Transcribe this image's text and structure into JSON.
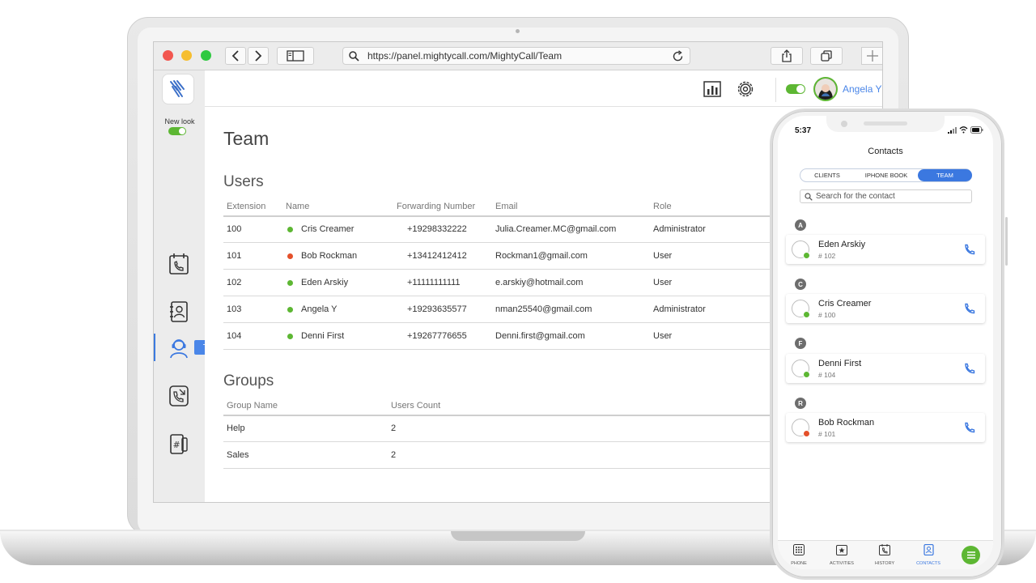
{
  "browser": {
    "url": "https://panel.mightycall.com/MightyCall/Team"
  },
  "sidebar": {
    "new_look_label": "New look",
    "tooltip": "Team",
    "items": [
      {
        "icon": "calendar-phone-icon"
      },
      {
        "icon": "contacts-book-icon"
      },
      {
        "icon": "team-headset-icon"
      },
      {
        "icon": "call-forward-icon"
      },
      {
        "icon": "phone-numbers-icon"
      }
    ]
  },
  "header": {
    "user_name": "Angela Y"
  },
  "page": {
    "title": "Team",
    "users_title": "Users",
    "users_columns": [
      "Extension",
      "Name",
      "Forwarding Number",
      "Email",
      "Role"
    ],
    "users": [
      {
        "extension": "100",
        "name": "Cris Creamer",
        "forwarding": "+19298332222",
        "email": "Julia.Creamer.MC@gmail.com",
        "role": "Administrator",
        "status_color": "#5db733"
      },
      {
        "extension": "101",
        "name": "Bob Rockman",
        "forwarding": "+13412412412",
        "email": "Rockman1@gmail.com",
        "role": "User",
        "status_color": "#e4502a"
      },
      {
        "extension": "102",
        "name": "Eden Arskiy",
        "forwarding": "+11111111111",
        "email": "e.arskiy@hotmail.com",
        "role": "User",
        "status_color": "#5db733"
      },
      {
        "extension": "103",
        "name": "Angela Y",
        "forwarding": "+19293635577",
        "email": "nman25540@gmail.com",
        "role": "Administrator",
        "status_color": "#5db733"
      },
      {
        "extension": "104",
        "name": "Denni First",
        "forwarding": "+19267776655",
        "email": "Denni.first@gmail.com",
        "role": "User",
        "status_color": "#5db733"
      }
    ],
    "groups_title": "Groups",
    "groups_columns": [
      "Group Name",
      "Users Count"
    ],
    "groups": [
      {
        "name": "Help",
        "count": "2"
      },
      {
        "name": "Sales",
        "count": "2"
      }
    ]
  },
  "phone": {
    "time": "5:37",
    "title": "Contacts",
    "segments": [
      "CLIENTS",
      "IPHONE BOOK",
      "TEAM"
    ],
    "active_segment": "TEAM",
    "search_placeholder": "Search for the contact",
    "contacts": [
      {
        "letter": "A",
        "name": "Eden Arskiy",
        "ext": "# 102",
        "status_color": "#5db733"
      },
      {
        "letter": "C",
        "name": "Cris Creamer",
        "ext": "# 100",
        "status_color": "#5db733"
      },
      {
        "letter": "F",
        "name": "Denni First",
        "ext": "# 104",
        "status_color": "#5db733"
      },
      {
        "letter": "R",
        "name": "Bob Rockman",
        "ext": "# 101",
        "status_color": "#e4502a"
      }
    ],
    "tabs": [
      "PHONE",
      "ACTIVITIES",
      "HISTORY",
      "CONTACTS"
    ],
    "active_tab": "CONTACTS"
  },
  "colors": {
    "accent": "#3b78e0",
    "online": "#5db733",
    "busy": "#e4502a"
  }
}
